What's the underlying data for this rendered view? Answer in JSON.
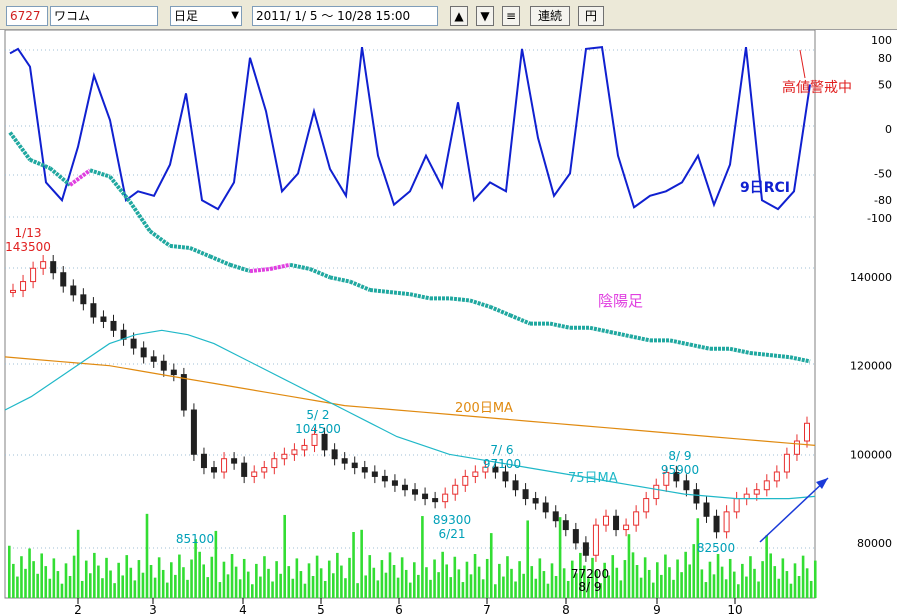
{
  "toolbar": {
    "code": "6727",
    "name": "ワコム",
    "period": "日足",
    "dropdown_arrow": "▼",
    "date_range": "2011/ 1/ 5 ～ 10/28 15:00",
    "up_btn": "▲",
    "down_btn": "▼",
    "menu_btn": "≡",
    "continuous_btn": "連続",
    "yen_btn": "円"
  },
  "colors": {
    "rci": "#1020d0",
    "ma200": "#e08a10",
    "ma75": "#20b8c8",
    "volume": "#33dd33",
    "candle_up": "#e83030",
    "candle_down": "#202020",
    "inyou_up": "#e040e0",
    "inyou_down": "#20a8a0",
    "annot_red": "#e02020",
    "annot_cyan": "#00a0b8"
  },
  "chart_data": [
    {
      "type": "line",
      "name": "RCI panel",
      "ylim": [
        -100,
        100
      ],
      "yticks": [
        "100",
        "80",
        "50",
        "0",
        "-50",
        "-80",
        "-100"
      ],
      "series": [
        {
          "name": "9日RCI",
          "x": [
            0,
            2,
            5,
            9,
            13,
            17,
            21,
            25,
            29,
            32,
            36,
            40,
            44,
            48,
            52,
            56,
            60,
            64,
            68,
            72,
            76,
            80,
            84,
            88,
            92,
            96,
            100,
            104,
            108,
            112,
            116,
            120,
            124,
            128,
            132,
            136,
            140,
            144,
            148,
            152,
            156,
            160,
            164,
            168,
            172,
            176,
            180,
            184,
            188,
            192,
            196,
            200
          ],
          "values": [
            85,
            90,
            70,
            -60,
            -80,
            -20,
            60,
            10,
            -80,
            -70,
            -75,
            -40,
            40,
            -80,
            -90,
            -60,
            80,
            20,
            -70,
            -50,
            20,
            -45,
            -75,
            92,
            -30,
            -85,
            -70,
            -30,
            -65,
            30,
            -80,
            -60,
            -70,
            90,
            -10,
            -75,
            -50,
            90,
            92,
            -30,
            -88,
            -75,
            -70,
            -60,
            -30,
            -85,
            -40,
            92,
            -80,
            -90,
            -70,
            50
          ],
          "label": "9日RCI"
        }
      ],
      "labels_right": [
        {
          "text": "9日RCI"
        }
      ],
      "annotations": [
        {
          "text": "高値警戒中"
        }
      ]
    },
    {
      "type": "line",
      "name": "陰陽足 (inline with RCI panel)",
      "series": [
        {
          "name": "陰陽足",
          "label": "陰陽足",
          "x": [
            0,
            5,
            10,
            15,
            20,
            25,
            30,
            35,
            40,
            45,
            50,
            55,
            60,
            65,
            70,
            75,
            80,
            85,
            90,
            95,
            100,
            105,
            110,
            115,
            120,
            125,
            130,
            135,
            140,
            145,
            150,
            155,
            160,
            165,
            170,
            175,
            180,
            185,
            190,
            195,
            200
          ],
          "values": [
            125,
            190,
            210,
            250,
            215,
            230,
            290,
            360,
            395,
            400,
            420,
            440,
            455,
            450,
            440,
            450,
            470,
            480,
            500,
            505,
            510,
            520,
            520,
            525,
            540,
            560,
            580,
            580,
            590,
            590,
            600,
            610,
            620,
            620,
            630,
            640,
            640,
            650,
            655,
            660,
            670
          ]
        }
      ]
    },
    {
      "type": "bar",
      "name": "Price (candles) with moving averages and volume",
      "ylim": [
        70000,
        150000
      ],
      "yticks": [
        140000,
        120000,
        100000,
        80000
      ],
      "xticks": [
        "2",
        "3",
        "4",
        "5",
        "6",
        "7",
        "8",
        "9",
        "10"
      ],
      "close": [
        137000,
        139000,
        142000,
        143500,
        141000,
        138000,
        136000,
        134000,
        131000,
        130000,
        128000,
        126000,
        124000,
        122000,
        121000,
        119000,
        118000,
        110000,
        100000,
        97000,
        96000,
        99000,
        98000,
        95000,
        96000,
        97000,
        99000,
        100000,
        101000,
        102000,
        104500,
        101000,
        99000,
        98000,
        97000,
        96000,
        95000,
        94000,
        93000,
        92000,
        91000,
        90000,
        89300,
        91000,
        93000,
        95000,
        96000,
        97100,
        96000,
        94000,
        92000,
        90000,
        89000,
        87000,
        85000,
        83000,
        80000,
        77200,
        84000,
        86000,
        83000,
        84000,
        87000,
        90000,
        93000,
        95900,
        94000,
        92000,
        89000,
        86000,
        82500,
        87000,
        90000,
        91000,
        92000,
        94000,
        96000,
        100000,
        103000,
        107000
      ],
      "series": [
        {
          "name": "200日MA",
          "label": "200日MA",
          "values": [
            122000,
            121500,
            121000,
            120500,
            120000,
            119000,
            118000,
            117000,
            116000,
            115000,
            114000,
            113000,
            112000,
            111000,
            110500,
            110000,
            109500,
            109000,
            108500,
            108000,
            107500,
            107000,
            106500,
            106000,
            105500,
            105000,
            104500,
            104000,
            103500,
            103000,
            102500,
            102000
          ]
        },
        {
          "name": "75日MA",
          "label": "75日MA",
          "values": [
            110000,
            113000,
            117000,
            121000,
            125000,
            127000,
            128000,
            127000,
            125000,
            122000,
            119000,
            116000,
            113000,
            110000,
            107000,
            104000,
            102000,
            100000,
            99000,
            98000,
            97000,
            96000,
            95000,
            94000,
            93000,
            92000,
            91000,
            90500,
            90000,
            90000,
            90000,
            90500
          ]
        }
      ],
      "annotations": [
        {
          "text": "1/13"
        },
        {
          "text": "143500"
        },
        {
          "text": "5/ 2"
        },
        {
          "text": "104500"
        },
        {
          "text": "89300"
        },
        {
          "text": "6/21"
        },
        {
          "text": "7/ 6"
        },
        {
          "text": "97100"
        },
        {
          "text": "8/ 9"
        },
        {
          "text": "95900"
        },
        {
          "text": "85100"
        },
        {
          "text": "82500"
        },
        {
          "text": "77200"
        },
        {
          "text": "8/ 9"
        }
      ]
    }
  ]
}
